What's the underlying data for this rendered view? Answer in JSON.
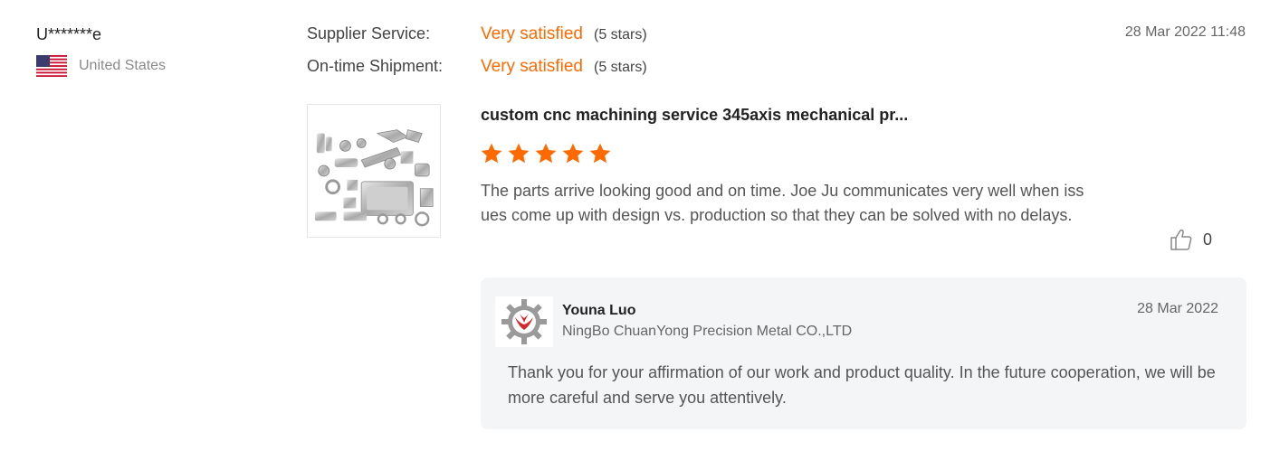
{
  "reviewer": {
    "name": "U*******e",
    "country": "United States",
    "flag_icon": "us-flag-icon"
  },
  "ratings": [
    {
      "label": "Supplier Service:",
      "value": "Very satisfied",
      "stars": "(5 stars)"
    },
    {
      "label": "On-time Shipment:",
      "value": "Very satisfied",
      "stars": "(5 stars)"
    }
  ],
  "review": {
    "date": "28 Mar 2022 11:48",
    "product_title": "custom cnc machining service 345axis mechanical pr...",
    "star_rating": 5,
    "text": "The parts arrive looking good and on time. Joe Ju communicates very well when issues come up with design vs. production so that they can be solved with no delays.",
    "likes": "0"
  },
  "reply": {
    "seller_name": "Youna Luo",
    "company": "NingBo ChuanYong Precision Metal CO.,LTD",
    "date": "28 Mar 2022",
    "text": "Thank you for your affirmation of our work and product quality. In the future cooperation, we will be more careful and serve you attentively."
  },
  "colors": {
    "accent": "#ff6a00",
    "muted": "#8a8a8a",
    "reply_bg": "#f4f5f7"
  }
}
